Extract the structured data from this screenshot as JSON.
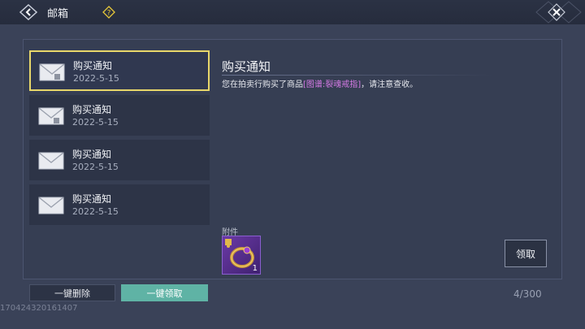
{
  "header": {
    "title": "邮箱",
    "help_icon": "question-diamond-icon",
    "back_icon": "back-arrow-icon",
    "close_icon": "close-x-icon"
  },
  "mail_list": [
    {
      "title": "购买通知",
      "date": "2022-5-15",
      "selected": true
    },
    {
      "title": "购买通知",
      "date": "2022-5-15",
      "selected": false
    },
    {
      "title": "购买通知",
      "date": "2022-5-15",
      "selected": false
    },
    {
      "title": "购买通知",
      "date": "2022-5-15",
      "selected": false
    }
  ],
  "detail": {
    "title": "购买通知",
    "body_prefix": "您在拍卖行购买了商品",
    "item_name": "[图谱:裂魂戒指]",
    "body_suffix": "，请注意查收。",
    "attachment_label": "附件",
    "attachment_qty": "1",
    "claim_label": "领取"
  },
  "footer": {
    "delete_all_label": "一键删除",
    "claim_all_label": "一键领取",
    "counter": "4/300",
    "uid": "170424320161407"
  },
  "colors": {
    "selected_border": "#e8d76a",
    "item_link": "#d67be6",
    "claim_all_bg": "#5fb3a5"
  }
}
